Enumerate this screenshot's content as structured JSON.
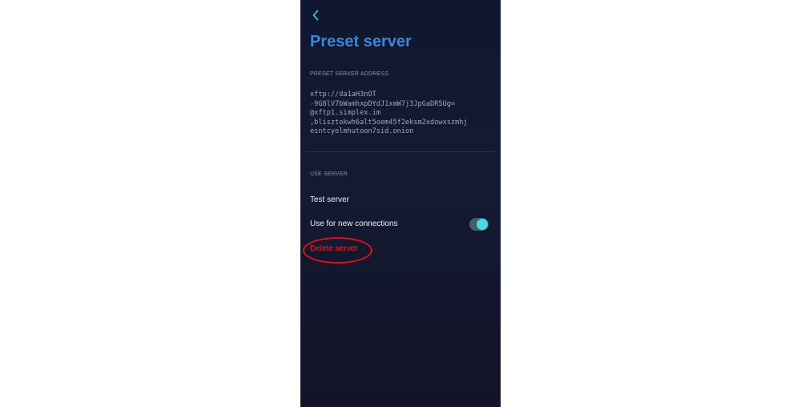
{
  "header": {
    "back_icon": "chevron-left-icon",
    "title": "Preset server"
  },
  "preset_section": {
    "label": "PRESET SERVER ADDRESS",
    "address": "xftp://da1aH3nOT\n-9G8lV7bWamhxpDYdJ1xmW7j3JpGaDR5Ug=\n@xftp1.simplex.im\n,bliszt​okwh6alt5oem45f2eksm2xdowxszmhj\nesntcyolmhutoon7sid.onion"
  },
  "use_section": {
    "label": "USE SERVER",
    "test_label": "Test server",
    "new_connections_label": "Use for new connections",
    "new_connections_enabled": true,
    "delete_label": "Delete server"
  },
  "colors": {
    "title": "#3b86d9",
    "delete": "#ff1e1e",
    "toggle_on": "#4fd7e6"
  }
}
